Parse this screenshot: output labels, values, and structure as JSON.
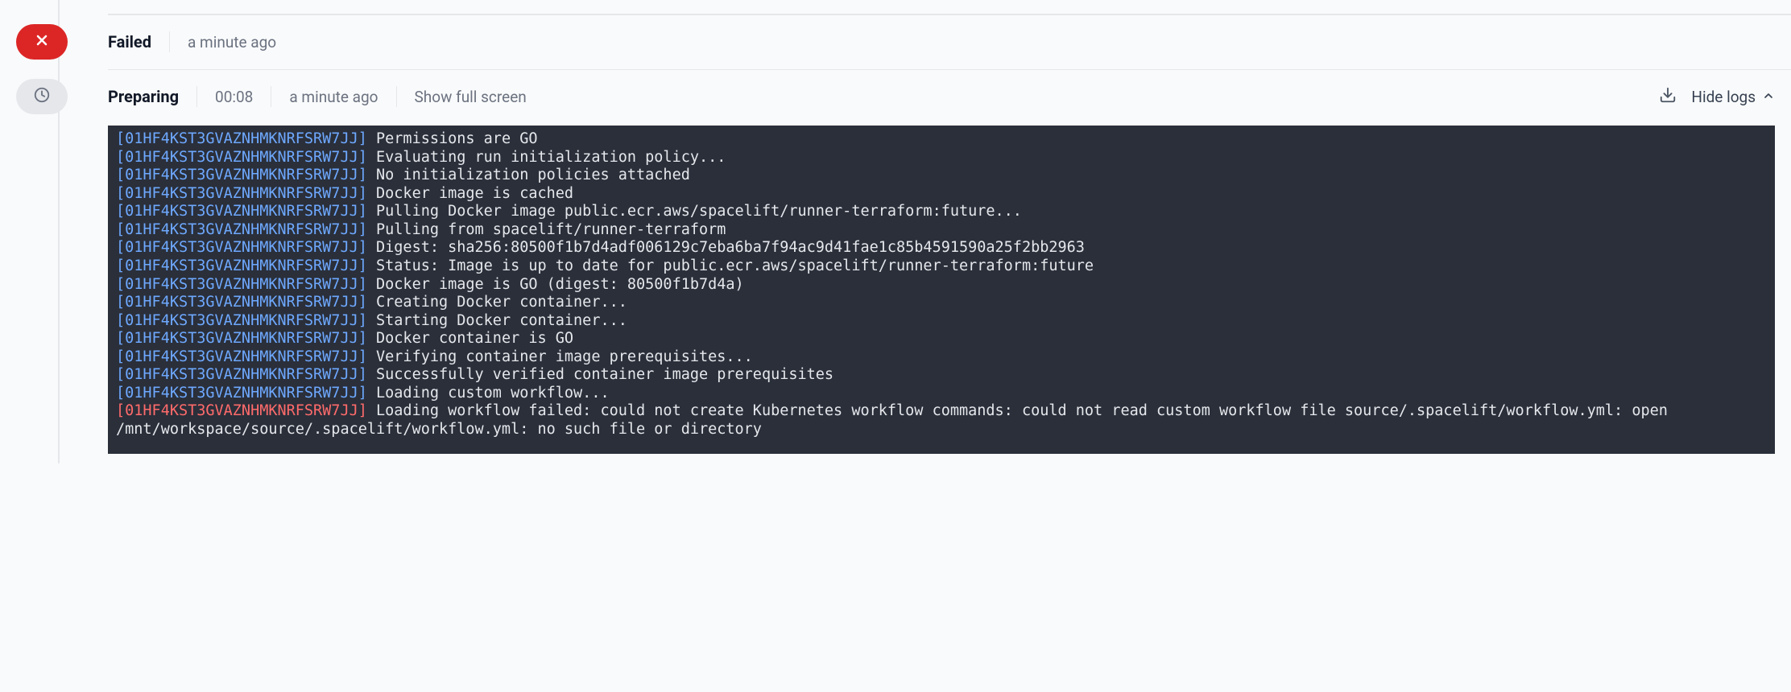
{
  "failed": {
    "title": "Failed",
    "timestamp": "a minute ago"
  },
  "preparing": {
    "title": "Preparing",
    "duration": "00:08",
    "timestamp": "a minute ago",
    "fullscreen_label": "Show full screen",
    "hide_logs_label": "Hide logs"
  },
  "log_id": "[01HF4KST3GVAZNHMKNRFSRW7JJ]",
  "logs": [
    {
      "tag": "[01HF4KST3GVAZNHMKNRFSRW7JJ]",
      "msg": "Permissions are GO",
      "error": false
    },
    {
      "tag": "[01HF4KST3GVAZNHMKNRFSRW7JJ]",
      "msg": "Evaluating run initialization policy...",
      "error": false
    },
    {
      "tag": "[01HF4KST3GVAZNHMKNRFSRW7JJ]",
      "msg": "No initialization policies attached",
      "error": false
    },
    {
      "tag": "[01HF4KST3GVAZNHMKNRFSRW7JJ]",
      "msg": "Docker image is cached",
      "error": false
    },
    {
      "tag": "[01HF4KST3GVAZNHMKNRFSRW7JJ]",
      "msg": "Pulling Docker image public.ecr.aws/spacelift/runner-terraform:future...",
      "error": false
    },
    {
      "tag": "[01HF4KST3GVAZNHMKNRFSRW7JJ]",
      "msg": "Pulling from spacelift/runner-terraform",
      "error": false
    },
    {
      "tag": "[01HF4KST3GVAZNHMKNRFSRW7JJ]",
      "msg": "Digest: sha256:80500f1b7d4adf006129c7eba6ba7f94ac9d41fae1c85b4591590a25f2bb2963",
      "error": false
    },
    {
      "tag": "[01HF4KST3GVAZNHMKNRFSRW7JJ]",
      "msg": "Status: Image is up to date for public.ecr.aws/spacelift/runner-terraform:future",
      "error": false
    },
    {
      "tag": "[01HF4KST3GVAZNHMKNRFSRW7JJ]",
      "msg": "Docker image is GO (digest: 80500f1b7d4a)",
      "error": false
    },
    {
      "tag": "[01HF4KST3GVAZNHMKNRFSRW7JJ]",
      "msg": "Creating Docker container...",
      "error": false
    },
    {
      "tag": "[01HF4KST3GVAZNHMKNRFSRW7JJ]",
      "msg": "Starting Docker container...",
      "error": false
    },
    {
      "tag": "[01HF4KST3GVAZNHMKNRFSRW7JJ]",
      "msg": "Docker container is GO",
      "error": false
    },
    {
      "tag": "[01HF4KST3GVAZNHMKNRFSRW7JJ]",
      "msg": "Verifying container image prerequisites...",
      "error": false
    },
    {
      "tag": "[01HF4KST3GVAZNHMKNRFSRW7JJ]",
      "msg": "Successfully verified container image prerequisites",
      "error": false
    },
    {
      "tag": "[01HF4KST3GVAZNHMKNRFSRW7JJ]",
      "msg": "Loading custom workflow...",
      "error": false
    },
    {
      "tag": "[01HF4KST3GVAZNHMKNRFSRW7JJ]",
      "msg": "Loading workflow failed: could not create Kubernetes workflow commands: could not read custom workflow file source/.spacelift/workflow.yml: open /mnt/workspace/source/.spacelift/workflow.yml: no such file or directory",
      "error": true
    }
  ]
}
